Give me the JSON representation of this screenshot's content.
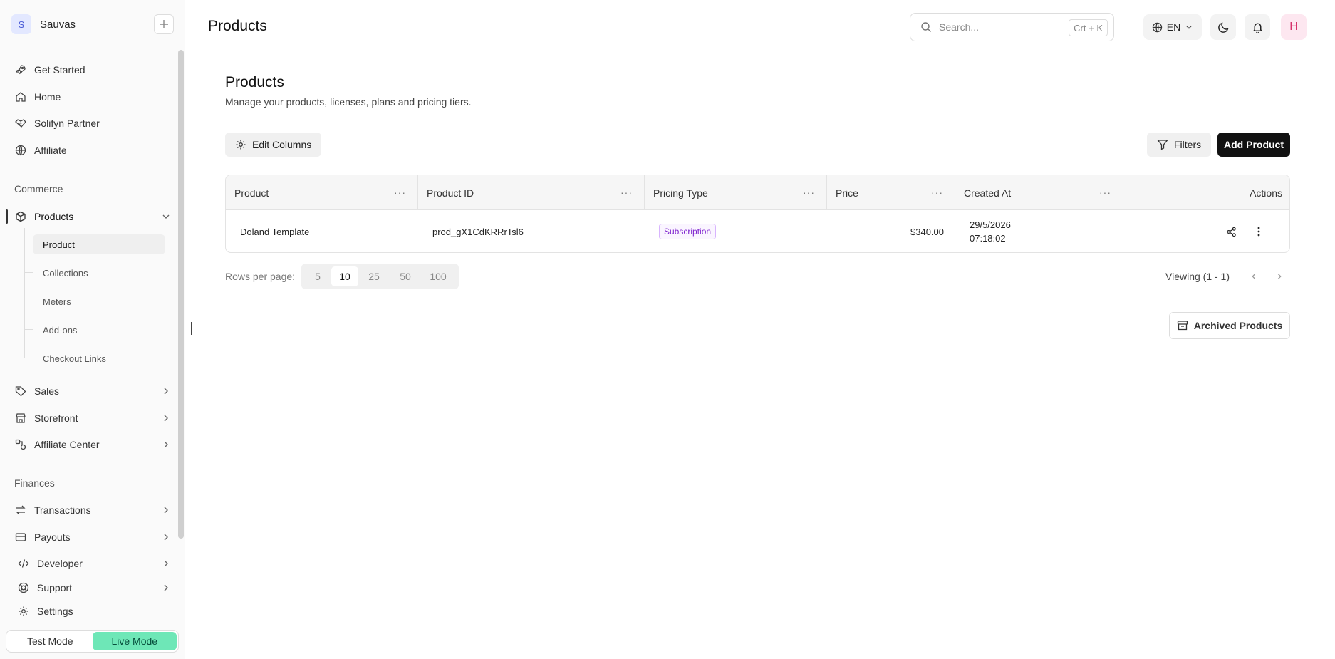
{
  "workspace": {
    "initial": "S",
    "name": "Sauvas",
    "add_icon": "plus-icon"
  },
  "sidebar": {
    "top_items": [
      {
        "label": "Get Started",
        "icon": "rocket-icon"
      },
      {
        "label": "Home",
        "icon": "home-icon"
      },
      {
        "label": "Solifyn Partner",
        "icon": "handshake-icon"
      },
      {
        "label": "Affiliate",
        "icon": "globe-icon"
      }
    ],
    "commerce_label": "Commerce",
    "products": {
      "label": "Products",
      "icon": "box-icon",
      "expanded": true
    },
    "product_subitems": [
      "Product",
      "Collections",
      "Meters",
      "Add-ons",
      "Checkout Links"
    ],
    "active_subitem": "Product",
    "commerce_items": [
      {
        "label": "Sales",
        "icon": "tag-icon"
      },
      {
        "label": "Storefront",
        "icon": "store-icon"
      },
      {
        "label": "Affiliate Center",
        "icon": "affiliate-icon"
      }
    ],
    "finances_label": "Finances",
    "finance_items": [
      {
        "label": "Transactions",
        "icon": "arrows-swap-icon"
      },
      {
        "label": "Payouts",
        "icon": "card-icon"
      }
    ],
    "bottom_items": [
      {
        "label": "Developer",
        "icon": "code-icon"
      },
      {
        "label": "Support",
        "icon": "lifebuoy-icon"
      },
      {
        "label": "Settings",
        "icon": "gear-icon"
      }
    ],
    "mode": {
      "test": "Test Mode",
      "live": "Live Mode",
      "active": "Live Mode"
    }
  },
  "header": {
    "title": "Products",
    "search_placeholder": "Search...",
    "search_shortcut": "Crt + K",
    "language": "EN",
    "user_initial": "H"
  },
  "main": {
    "title": "Products",
    "description": "Manage your products, licenses, plans and pricing tiers.",
    "edit_columns": "Edit Columns",
    "filters": "Filters",
    "add_product": "Add Product",
    "archived": "Archived Products"
  },
  "table": {
    "columns": [
      "Product",
      "Product ID",
      "Pricing Type",
      "Price",
      "Created At",
      "Actions"
    ],
    "rows": [
      {
        "product": "Doland Template",
        "product_id": "prod_gX1CdKRRrTsl6",
        "pricing_type": "Subscription",
        "price": "$340.00",
        "created_date": "29/5/2026",
        "created_time": "07:18:02"
      }
    ]
  },
  "pagination": {
    "rows_label": "Rows per page:",
    "options": [
      "5",
      "10",
      "25",
      "50",
      "100"
    ],
    "selected": "10",
    "viewing": "Viewing (1 - 1)"
  },
  "colors": {
    "accent_live": "#6ee7b7",
    "primary_button": "#111111",
    "badge_purple": "#7e22ce",
    "avatar_pink": "#d6336c"
  }
}
